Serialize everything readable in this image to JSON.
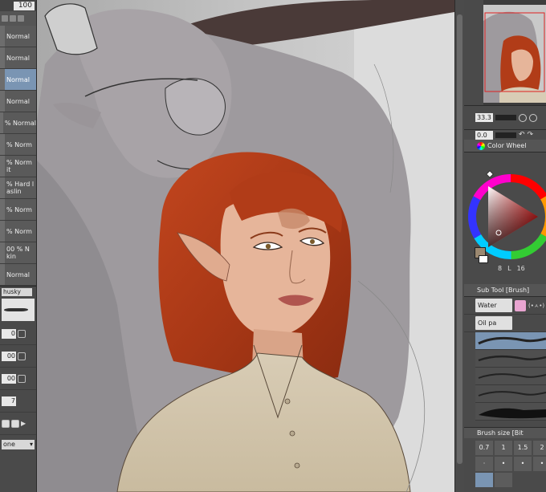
{
  "left_panel": {
    "opacity_value": "100",
    "layers": [
      {
        "label": "Normal",
        "selected": false
      },
      {
        "label": "Normal",
        "selected": false
      },
      {
        "label": "Normal",
        "selected": true
      },
      {
        "label": "Normal",
        "selected": false
      },
      {
        "label": "% Normal",
        "selected": false
      },
      {
        "label": "% Norm",
        "selected": false
      },
      {
        "label": "% Norm",
        "selected": false
      },
      {
        "label": "% Hard l",
        "selected": false
      },
      {
        "label": "% Norm",
        "selected": false
      },
      {
        "label": "% Norm",
        "selected": false
      },
      {
        "label": "00 % N",
        "selected": false
      },
      {
        "label": "Normal",
        "selected": false
      }
    ],
    "layer_sublabels": [
      "",
      "",
      "",
      "",
      "",
      "",
      "it",
      "aslin",
      "",
      "",
      "kin",
      ""
    ],
    "brush_tag": "husky",
    "slider_values": [
      "0",
      "00",
      "00"
    ],
    "stepper_value": "7",
    "blend_combo": "one"
  },
  "navigator": {
    "zoom": "33.3",
    "rotation": "0.0"
  },
  "color_wheel": {
    "title": "Color Wheel",
    "main_color": "#9b8870",
    "sub_values": [
      "8",
      "L",
      "16"
    ]
  },
  "sub_tool": {
    "title": "Sub Tool [Brush]",
    "buttons": [
      "Water",
      "Oil pa"
    ],
    "pink_label": "(•ㅅ•)"
  },
  "brush_size": {
    "title": "Brush size [Bit",
    "sizes": [
      "0.7",
      "1",
      "1.5",
      "2"
    ]
  }
}
